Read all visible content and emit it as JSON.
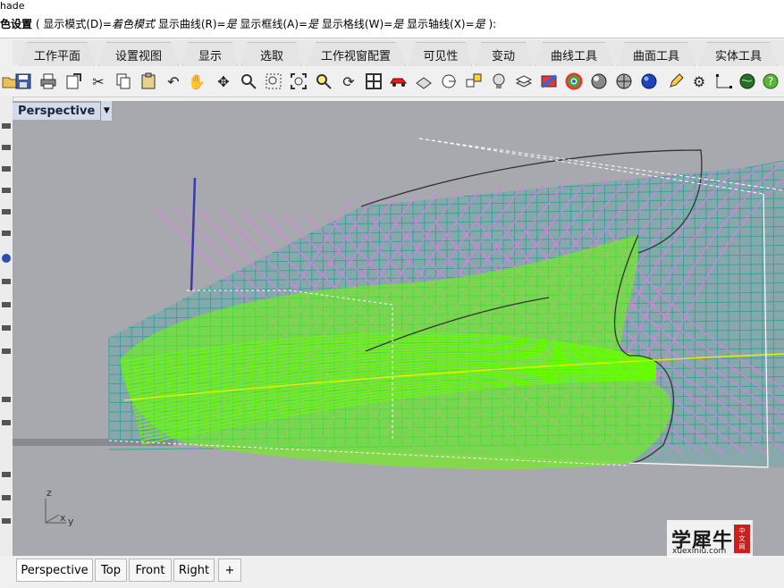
{
  "command": {
    "line1": "hade",
    "prefix": "色设置",
    "open_paren": " ( ",
    "mode_label": "显示模式(D)=",
    "mode_value": "着色模式",
    "curve_label": "  显示曲线(R)=",
    "curve_value": "是",
    "frame_label": "  显示框线(A)=",
    "frame_value": "是",
    "grid_label": "  显示格线(W)=",
    "grid_value": "是",
    "axis_label": "  显示轴线(X)=",
    "axis_value": "是",
    "close": " ):"
  },
  "tabs": [
    "工作平面",
    "设置视图",
    "显示",
    "选取",
    "工作视窗配置",
    "可见性",
    "变动",
    "曲线工具",
    "曲面工具",
    "实体工具"
  ],
  "toolbar_icons": [
    "open-icon",
    "save-icon",
    "print-icon",
    "export-icon",
    "cut-icon",
    "copy-icon",
    "paste-icon",
    "undo-icon",
    "pan-hand-icon",
    "rotate-view-icon",
    "zoom-icon",
    "zoom-window-icon",
    "zoom-extents-icon",
    "zoom-selected-icon",
    "rotate-camera-icon",
    "four-viewports-icon",
    "car-icon",
    "named-view-icon",
    "circle-target-icon",
    "object-properties-icon",
    "lightbulb-icon",
    "layer-icon",
    "color-wheel-icon",
    "shaded-sphere-icon",
    "rendered-sphere-icon",
    "blue-sphere-icon",
    "pencil-icon",
    "gear-icon",
    "points-icon",
    "globe-icon",
    "help-icon"
  ],
  "viewport": {
    "title": "Perspective",
    "axis_z": "z",
    "axis_x": "x",
    "axis_y": "y"
  },
  "bottom_tabs": [
    "Perspective",
    "Top",
    "Front",
    "Right"
  ],
  "add_tab": "+",
  "watermark": {
    "text": "学犀牛",
    "url": "xuexiniu.com",
    "badge": [
      "中",
      "文",
      "网"
    ]
  },
  "colors": {
    "viewport_bg": "#a8a9ae",
    "grid_teal": "#3aa2a0",
    "surface_green": "#66ff00",
    "isocurve_pink": "#e17be8",
    "axis_yellow": "#e8f000",
    "z_axis_blue": "#3a3aaa"
  }
}
